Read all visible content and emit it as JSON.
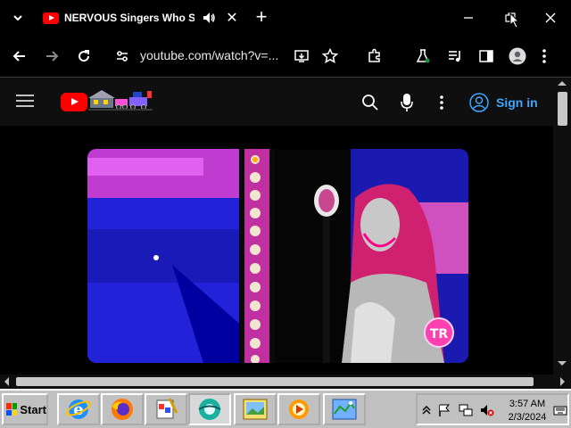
{
  "browser": {
    "tab": {
      "title": "NERVOUS Singers Who SH",
      "close_label": "✕"
    },
    "new_tab_label": "+",
    "address": {
      "url": "youtube.com/watch?v=..."
    }
  },
  "youtube": {
    "sign_in_label": "Sign in"
  },
  "taskbar": {
    "start_label": "Start",
    "clock": {
      "time": "3:57 AM",
      "date": "2/3/2024"
    }
  },
  "colors": {
    "accent_blue": "#3ea6ff",
    "youtube_red": "#ff0000",
    "taskbar_gray": "#c0c0c0"
  },
  "icons": [
    "chevron-down-icon",
    "youtube-favicon",
    "audio-icon",
    "close-icon",
    "plus-icon",
    "minimize-icon",
    "restore-icon",
    "back-arrow-icon",
    "forward-arrow-icon",
    "reload-icon",
    "site-settings-icon",
    "install-app-icon",
    "bookmark-star-icon",
    "extensions-icon",
    "labs-flask-icon",
    "media-control-icon",
    "side-panel-icon",
    "profile-icon",
    "more-vert-icon",
    "hamburger-menu-icon",
    "youtube-logo",
    "search-icon",
    "microphone-icon",
    "account-icon"
  ]
}
